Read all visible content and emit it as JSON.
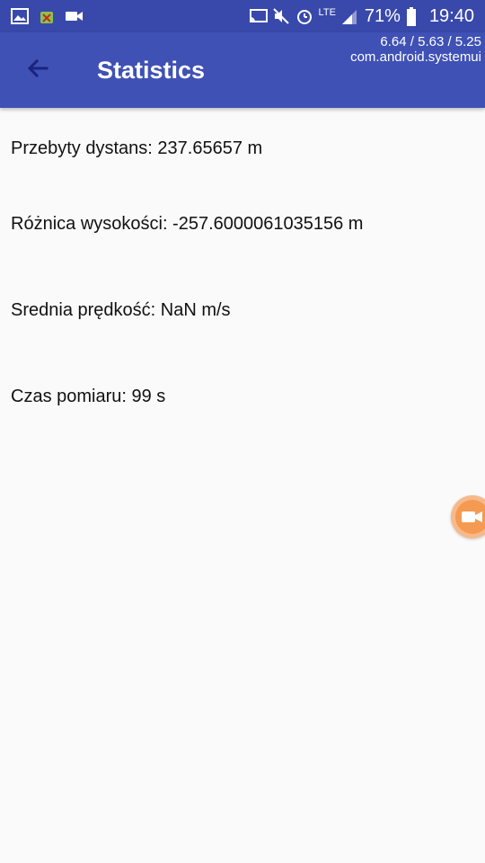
{
  "status_bar": {
    "battery_percent": "71%",
    "time": "19:40",
    "network_type": "LTE"
  },
  "overlay": {
    "line1": "6.64 / 5.63 / 5.25",
    "line2": "com.android.systemui"
  },
  "app_bar": {
    "title": "Statistics",
    "back_icon": "arrow-back-icon"
  },
  "stats": [
    {
      "label": "Przebyty dystans: 237.65657 m"
    },
    {
      "label": "Różnica wysokości: -257.6000061035156 m"
    },
    {
      "label": "Srednia prędkość: NaN m/s"
    },
    {
      "label": "Czas pomiaru: 99 s"
    }
  ],
  "colors": {
    "status_bar": "#3949ab",
    "app_bar": "#3f51b5",
    "background": "#fafafa",
    "record_button": "#f59a52"
  },
  "icons": {
    "status_left": [
      "image-icon",
      "android-debug-icon",
      "video-camera-icon"
    ],
    "status_right": [
      "cast-icon",
      "mute-vibrate-icon",
      "alarm-icon",
      "signal-icon",
      "battery-icon"
    ],
    "floating": "record-video-icon"
  }
}
